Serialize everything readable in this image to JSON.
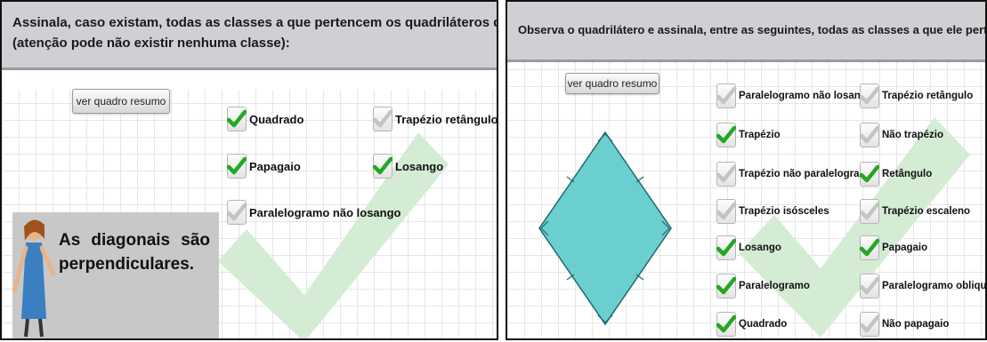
{
  "left_panel": {
    "header": {
      "line1": "Assinala, caso existam, todas as classes a que pertencem os quadriláteros que possuem a propriedade",
      "line2": "(atenção pode não existir nenhuma classe):"
    },
    "summary_button": "ver quadro resumo",
    "options": [
      {
        "label": "Quadrado",
        "checked": true
      },
      {
        "label": "Trapézio retângulo",
        "checked": false
      },
      {
        "label": "Papagaio",
        "checked": true
      },
      {
        "label": "Losango",
        "checked": true
      },
      {
        "label": "Paralelogramo não losango",
        "checked": false
      }
    ],
    "statement": "As diagonais são perpendiculares.",
    "big_check_color": "#cfe8cf"
  },
  "right_panel": {
    "header": "Observa o quadrilátero e assinala, entre as seguintes, todas as classes a que ele pertence.",
    "summary_button": "ver quadro resumo",
    "shape_color": "#6ccfcf",
    "options_col1": [
      {
        "label": "Paralelogramo não losango",
        "checked": false
      },
      {
        "label": "Trapézio",
        "checked": true
      },
      {
        "label": "Trapézio não paralelogramo",
        "checked": false
      },
      {
        "label": "Trapézio isósceles",
        "checked": false
      },
      {
        "label": "Losango",
        "checked": true
      },
      {
        "label": "Paralelogramo",
        "checked": true
      },
      {
        "label": "Quadrado",
        "checked": true
      }
    ],
    "options_col2": [
      {
        "label": "Trapézio retângulo",
        "checked": false
      },
      {
        "label": "Não trapézio",
        "checked": false
      },
      {
        "label": "Retângulo",
        "checked": true
      },
      {
        "label": "Trapézio escaleno",
        "checked": false
      },
      {
        "label": "Papagaio",
        "checked": true
      },
      {
        "label": "Paralelogramo obliquângulo",
        "checked": false
      },
      {
        "label": "Não papagaio",
        "checked": false
      }
    ]
  },
  "colors": {
    "check_green": "#22a822",
    "check_gray": "#c4c4c4",
    "header_bg": "#cfcfd4"
  }
}
